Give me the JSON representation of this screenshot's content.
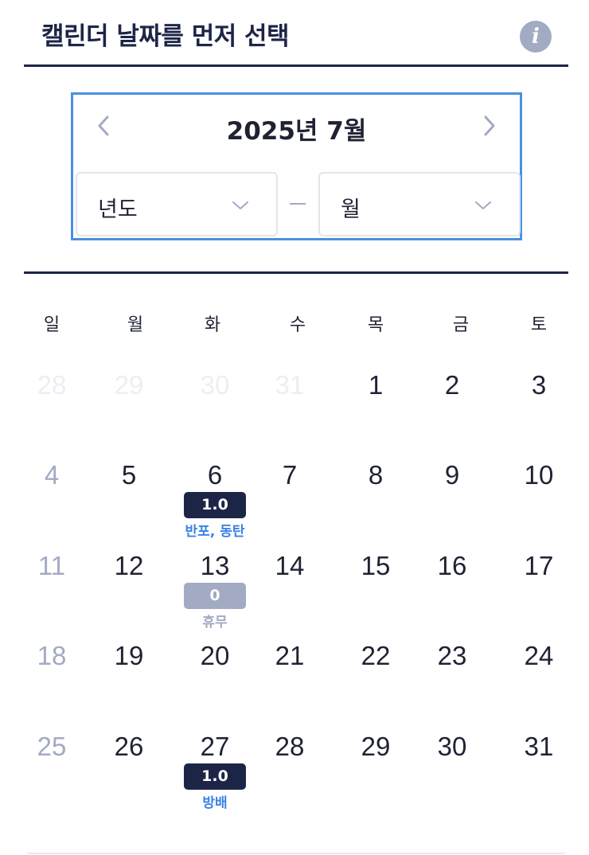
{
  "header": {
    "title": "캘린더 날짜를 먼저 선택",
    "info_icon": "i"
  },
  "month_picker": {
    "label": "2025년 7월",
    "prev_icon": "chevron-left-icon",
    "next_icon": "chevron-right-icon",
    "year_select": {
      "value": "년도"
    },
    "month_select": {
      "value": "월"
    }
  },
  "weekdays": [
    "일",
    "월",
    "화",
    "수",
    "목",
    "금",
    "토"
  ],
  "weeks": [
    [
      {
        "day": "28",
        "other": true
      },
      {
        "day": "29",
        "other": true
      },
      {
        "day": "30",
        "other": true
      },
      {
        "day": "31",
        "other": true
      },
      {
        "day": "1"
      },
      {
        "day": "2"
      },
      {
        "day": "3"
      }
    ],
    [
      {
        "day": "4"
      },
      {
        "day": "5"
      },
      {
        "day": "6",
        "badge": "1.0",
        "note": "반포, 동탄"
      },
      {
        "day": "7"
      },
      {
        "day": "8"
      },
      {
        "day": "9"
      },
      {
        "day": "10"
      }
    ],
    [
      {
        "day": "11"
      },
      {
        "day": "12"
      },
      {
        "day": "13",
        "badge": "0",
        "badge_muted": true,
        "note": "휴무",
        "note_muted": true
      },
      {
        "day": "14"
      },
      {
        "day": "15"
      },
      {
        "day": "16"
      },
      {
        "day": "17"
      }
    ],
    [
      {
        "day": "18"
      },
      {
        "day": "19"
      },
      {
        "day": "20"
      },
      {
        "day": "21"
      },
      {
        "day": "22"
      },
      {
        "day": "23"
      },
      {
        "day": "24"
      }
    ],
    [
      {
        "day": "25"
      },
      {
        "day": "26"
      },
      {
        "day": "27",
        "badge": "1.0",
        "note": "방배"
      },
      {
        "day": "28"
      },
      {
        "day": "29"
      },
      {
        "day": "30"
      },
      {
        "day": "31"
      }
    ]
  ],
  "colors": {
    "navy": "#1d2547",
    "accent_blue": "#3b82e6",
    "picker_border": "#4a90e2",
    "muted": "#a3aac3",
    "faded": "#eceef3"
  }
}
